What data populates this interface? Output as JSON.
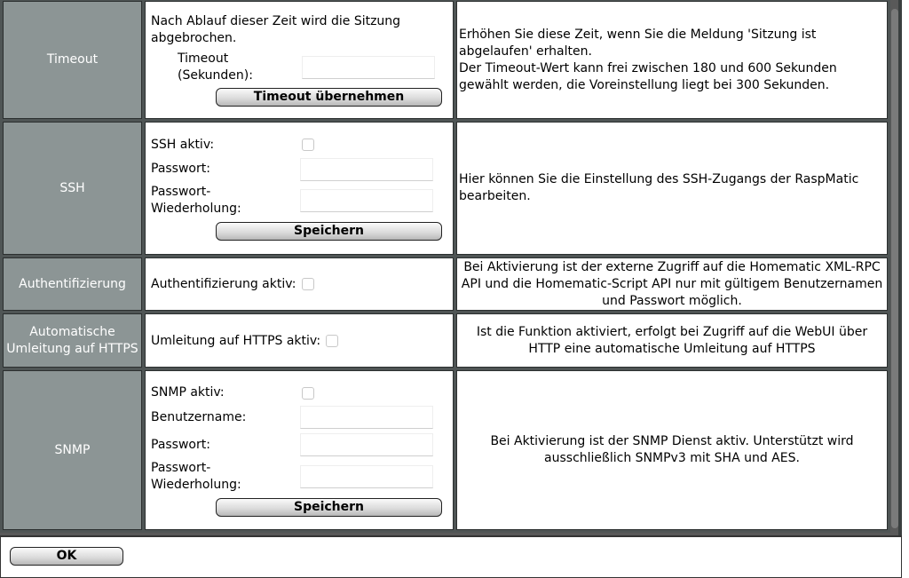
{
  "rows": {
    "timeout": {
      "label": "Timeout",
      "intro": "Nach Ablauf dieser Zeit wird die Sitzung abgebrochen.",
      "field_label": "Timeout (Sekunden):",
      "field_value": "",
      "button": "Timeout übernehmen",
      "description_1": "Erhöhen Sie diese Zeit, wenn Sie die Meldung 'Sitzung ist abgelaufen' erhalten.",
      "description_2": "Der Timeout-Wert kann frei zwischen 180 und 600 Sekunden gewählt werden, die Voreinstellung liegt bei 300 Sekunden."
    },
    "ssh": {
      "label": "SSH",
      "active_label": "SSH aktiv:",
      "active_checked": false,
      "password_label": "Passwort:",
      "password_value": "",
      "password_repeat_label": "Passwort-Wiederholung:",
      "password_repeat_value": "",
      "button": "Speichern",
      "description": "Hier können Sie die Einstellung des SSH-Zugangs der RaspMatic bearbeiten."
    },
    "auth": {
      "label": "Authentifizierung",
      "active_label": "Authentifizierung aktiv:",
      "active_checked": false,
      "description": "Bei Aktivierung ist der externe Zugriff auf die Homematic XML-RPC API und die Homematic-Script API nur mit gültigem Benutzernamen und Passwort möglich."
    },
    "https": {
      "label": "Automatische Umleitung auf HTTPS",
      "active_label": "Umleitung auf HTTPS aktiv:",
      "active_checked": false,
      "description": "Ist die Funktion aktiviert, erfolgt bei Zugriff auf die WebUI über HTTP eine automatische Umleitung auf HTTPS"
    },
    "snmp": {
      "label": "SNMP",
      "active_label": "SNMP aktiv:",
      "active_checked": false,
      "username_label": "Benutzername:",
      "username_value": "",
      "password_label": "Passwort:",
      "password_value": "",
      "password_repeat_label": "Passwort-Wiederholung:",
      "password_repeat_value": "",
      "button": "Speichern",
      "description": "Bei Aktivierung ist der SNMP Dienst aktiv. Unterstützt wird ausschließlich SNMPv3 mit SHA und AES."
    }
  },
  "footer": {
    "ok_label": "OK"
  }
}
